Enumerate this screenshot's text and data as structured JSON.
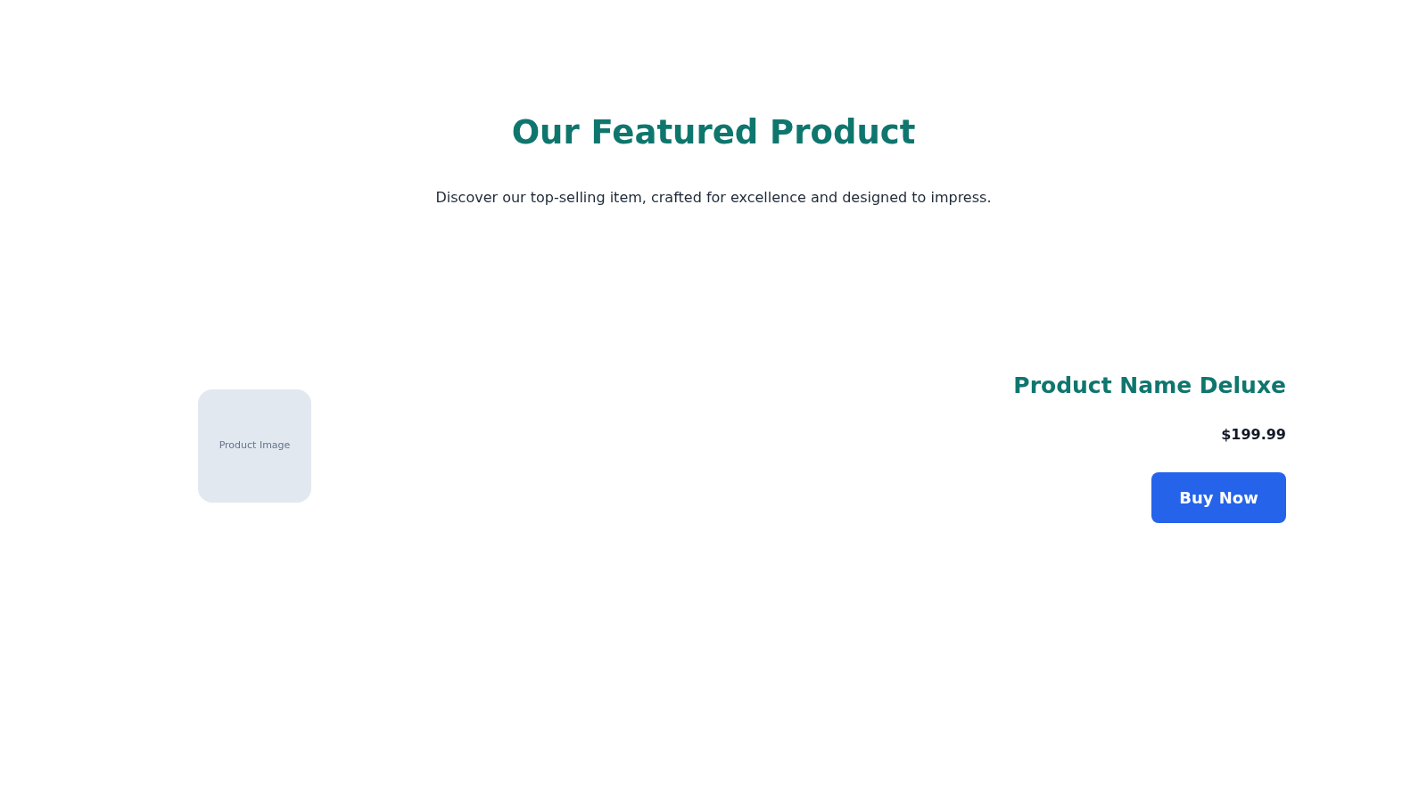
{
  "header": {
    "title": "Our Featured Product",
    "subtitle": "Discover our top-selling item, crafted for excellence and designed to impress."
  },
  "product": {
    "image_label": "Product Image",
    "name": "Product Name Deluxe",
    "price": "$199.99",
    "button": "Buy Now"
  }
}
